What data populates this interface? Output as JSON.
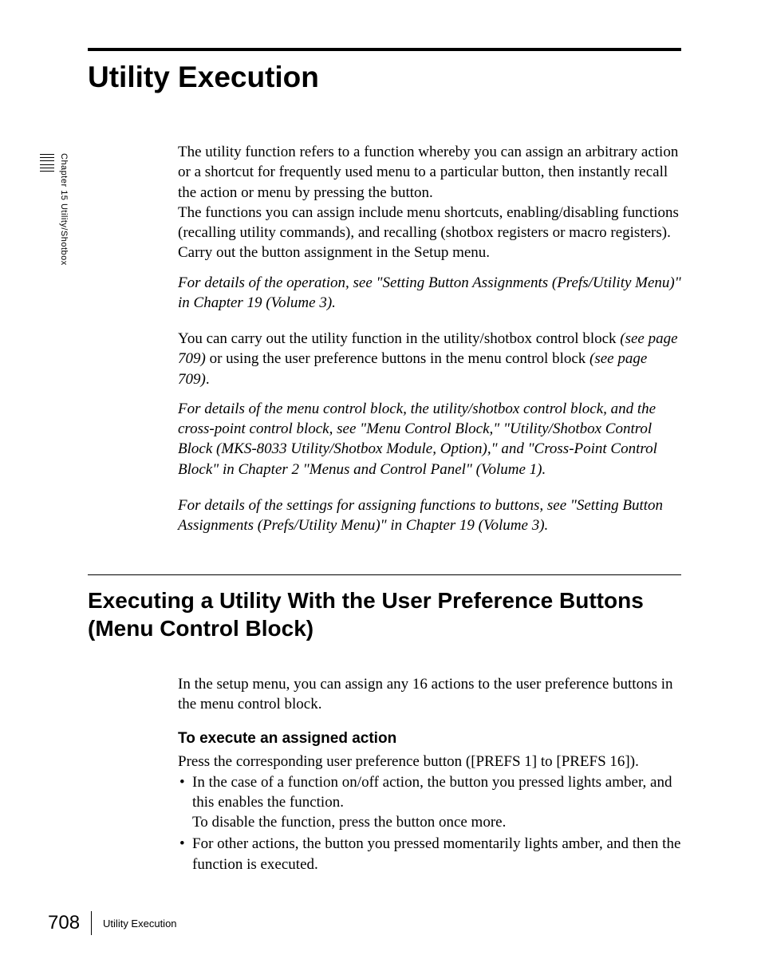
{
  "sideTab": {
    "label": "Chapter 15  Utility/Shotbox"
  },
  "mainHeading": "Utility Execution",
  "intro": {
    "para1a": "The utility function refers to a function whereby you can assign an arbitrary action or a shortcut for frequently used menu to a particular button, then instantly recall the action or menu by pressing the button.",
    "para1b": "The functions you can assign include menu shortcuts, enabling/disabling functions (recalling utility commands), and recalling (shotbox registers or macro registers).",
    "para1c": "Carry out the button assignment in the Setup menu.",
    "ref1": "For details of the operation, see \"Setting Button Assignments (Prefs/Utility Menu)\" in Chapter 19 (Volume 3).",
    "para2_pre1": "You can carry out the utility function in the utility/shotbox control block ",
    "para2_ref1": "(see page 709)",
    "para2_mid": " or using the user preference buttons in the menu control block ",
    "para2_ref2": "(see page 709)",
    "para2_post": ".",
    "ref2": "For details of the menu control block, the utility/shotbox control block, and the cross-point control block, see \"Menu Control Block,\" \"Utility/Shotbox Control Block (MKS-8033 Utility/Shotbox Module, Option),\" and \"Cross-Point Control Block\" in Chapter 2 \"Menus and Control Panel\" (Volume 1).",
    "ref3": "For details of the settings for assigning functions to buttons, see \"Setting Button Assignments (Prefs/Utility Menu)\" in Chapter 19 (Volume 3)."
  },
  "section": {
    "heading": "Executing a Utility With the User Preference Buttons (Menu Control Block)",
    "para1": "In the setup menu, you can assign any 16 actions to the user preference buttons in the menu control block.",
    "subHeading": "To execute an assigned action",
    "para2": "Press the corresponding user preference button ([PREFS 1] to [PREFS 16]).",
    "bullets": {
      "b1line1": "In the case of a function on/off action, the button you pressed lights amber, and this enables the function.",
      "b1line2": "To disable the function, press the button once more.",
      "b2": "For other actions, the button you pressed momentarily lights amber, and then the function is executed."
    }
  },
  "footer": {
    "pageNumber": "708",
    "label": "Utility Execution"
  }
}
